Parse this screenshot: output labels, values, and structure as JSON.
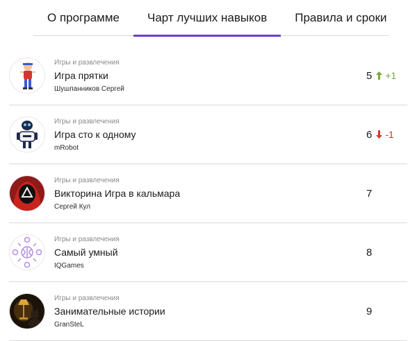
{
  "tabs": [
    {
      "label": "О программе",
      "active": false
    },
    {
      "label": "Чарт лучших навыков",
      "active": true
    },
    {
      "label": "Правила и сроки",
      "active": false
    }
  ],
  "skills": [
    {
      "category": "Игры и развлечения",
      "title": "Игра прятки",
      "author": "Шушпанников Сергей",
      "rank": "5",
      "delta": "+1",
      "trend": "up",
      "icon": "cartoon-boy-icon"
    },
    {
      "category": "Игры и развлечения",
      "title": "Игра сто к одному",
      "author": "mRobot",
      "rank": "6",
      "delta": "-1",
      "trend": "down",
      "icon": "robot-icon"
    },
    {
      "category": "Игры и развлечения",
      "title": "Викторина Игра в кальмара",
      "author": "Сергей Кул",
      "rank": "7",
      "delta": "",
      "trend": "none",
      "icon": "squid-game-guard-icon"
    },
    {
      "category": "Игры и развлечения",
      "title": "Самый умный",
      "author": "IQGames",
      "rank": "8",
      "delta": "",
      "trend": "none",
      "icon": "brain-network-icon"
    },
    {
      "category": "Игры и развлечения",
      "title": "Занимательные истории",
      "author": "GranSteL",
      "rank": "9",
      "delta": "",
      "trend": "none",
      "icon": "cat-lamp-icon"
    }
  ],
  "colors": {
    "accent": "#6a3cd6",
    "up": "#7aa83a",
    "down": "#d9342b"
  }
}
